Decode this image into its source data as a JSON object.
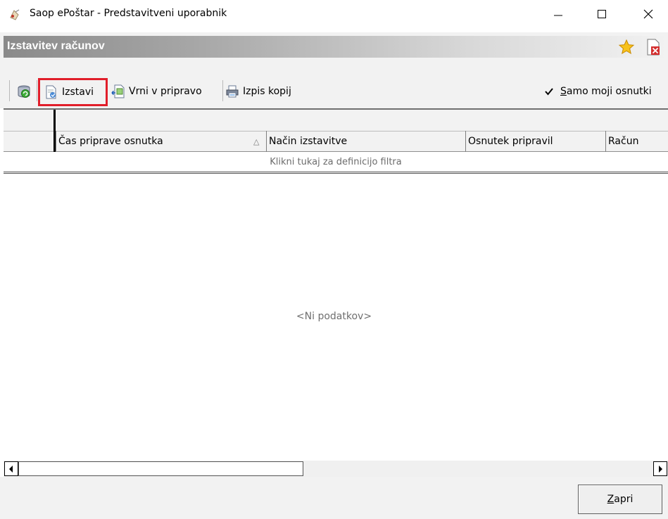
{
  "window": {
    "title": "Saop ePoštar - Predstavitveni uporabnik",
    "minimize_icon": "minimize-icon",
    "maximize_icon": "maximize-icon",
    "close_icon": "close-icon"
  },
  "header": {
    "title": "Izstavitev računov",
    "favorite_icon": "star-icon",
    "close_doc_icon": "document-close-icon"
  },
  "toolbar": {
    "refresh_icon": "refresh-icon",
    "izstavi_label": "Izstavi",
    "vrni_label": "Vrni v pripravo",
    "izpis_label": "Izpis kopij",
    "checkbox_label": "Samo moji osnutki",
    "checkbox_checked": true,
    "highlight_color": "#e11e2a"
  },
  "grid": {
    "columns": [
      "Čas priprave osnutka",
      "Način izstavitve",
      "Osnutek pripravil",
      "Račun"
    ],
    "sort_indicator": "△",
    "filter_text": "Klikni tukaj za definicijo filtra",
    "empty_text": "<Ni podatkov>"
  },
  "footer": {
    "close_label": "Zapri"
  }
}
